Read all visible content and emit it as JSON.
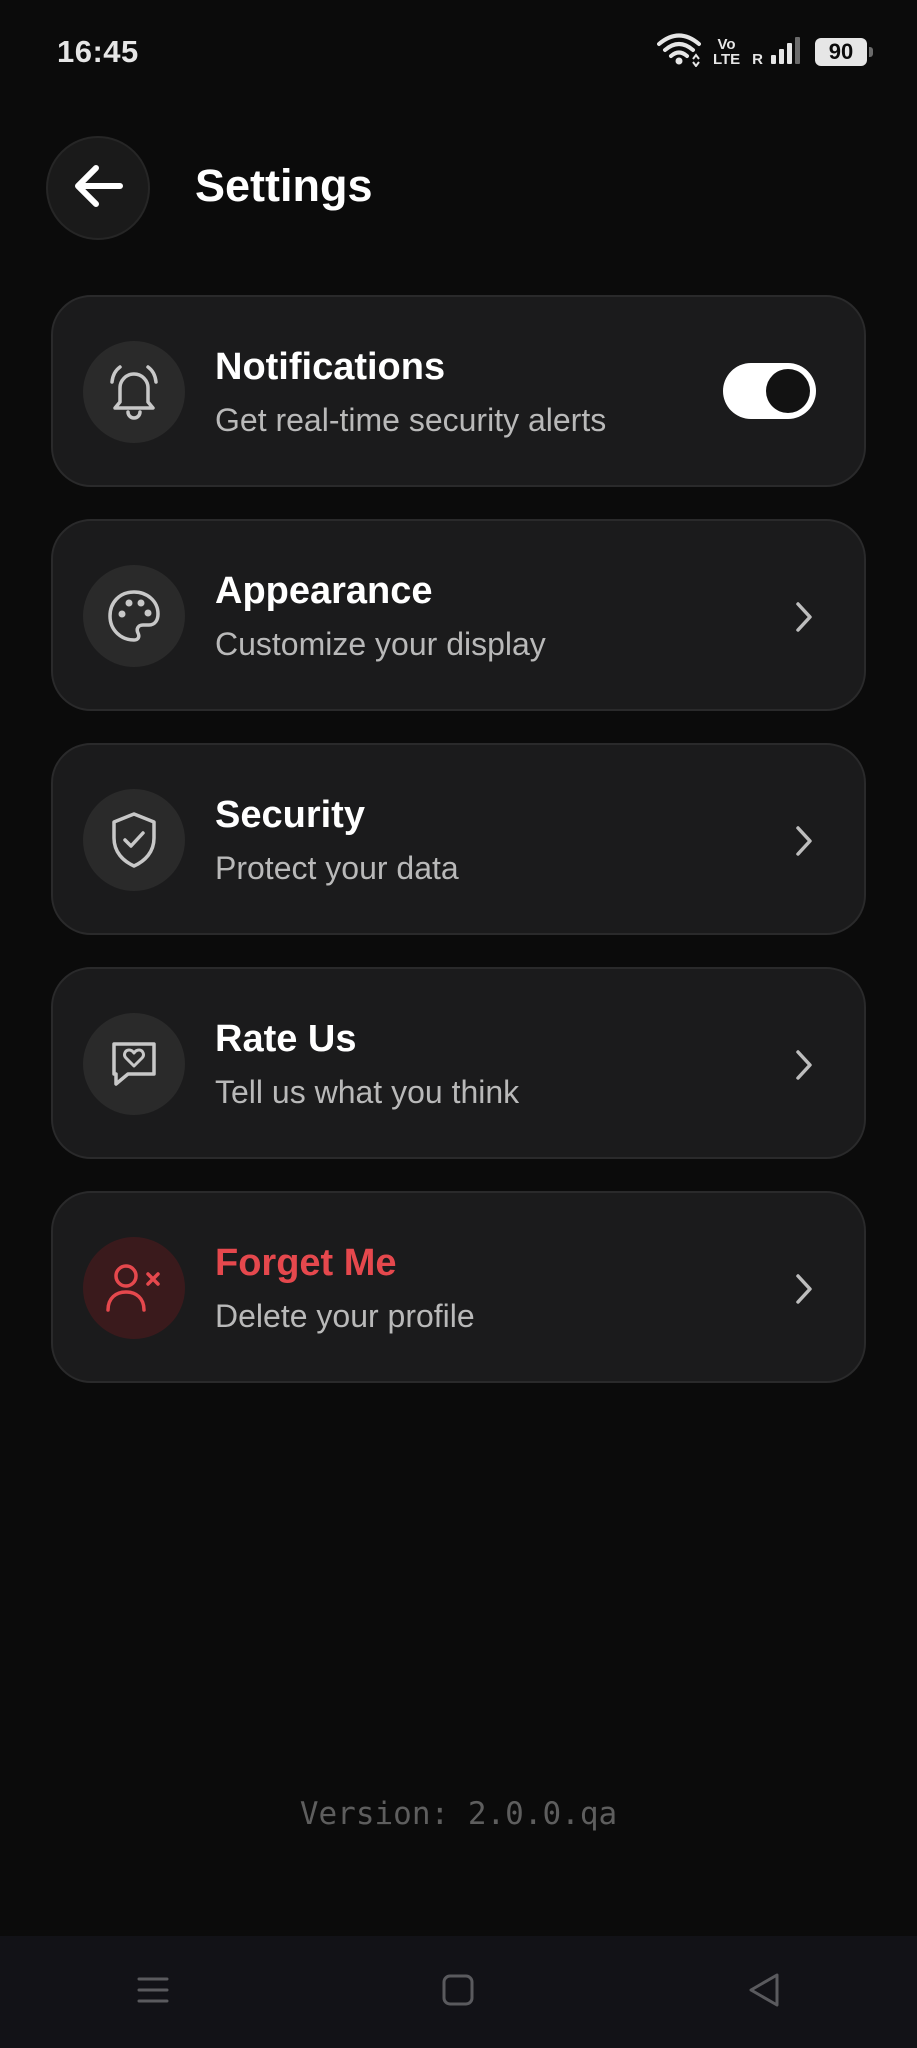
{
  "status_bar": {
    "time": "16:45",
    "volte_top": "Vo",
    "volte_bottom": "LTE",
    "roaming": "R",
    "battery": "90"
  },
  "header": {
    "title": "Settings",
    "back_icon": "arrow-left-icon"
  },
  "settings": [
    {
      "icon": "bell-icon",
      "title": "Notifications",
      "subtitle": "Get real-time security alerts",
      "control": "toggle",
      "toggle_on": true
    },
    {
      "icon": "palette-icon",
      "title": "Appearance",
      "subtitle": "Customize your display",
      "control": "chevron"
    },
    {
      "icon": "shield-check-icon",
      "title": "Security",
      "subtitle": "Protect your data",
      "control": "chevron"
    },
    {
      "icon": "message-heart-icon",
      "title": "Rate Us",
      "subtitle": "Tell us what you think",
      "control": "chevron"
    },
    {
      "icon": "user-x-icon",
      "title": "Forget Me",
      "subtitle": "Delete your profile",
      "control": "chevron",
      "danger": true
    }
  ],
  "footer": {
    "version": "Version: 2.0.0.qa"
  },
  "colors": {
    "background": "#0b0b0b",
    "card": "#1b1b1c",
    "danger": "#e5484d",
    "text_secondary": "#b9b9b9"
  }
}
